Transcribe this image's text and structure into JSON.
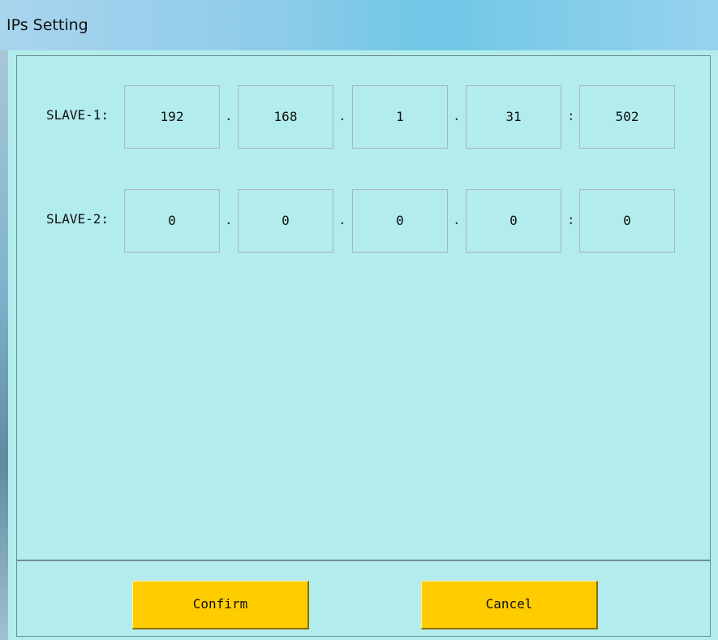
{
  "window": {
    "title": "IPs Setting"
  },
  "slaves": [
    {
      "label": "SLAVE-1:",
      "octets": [
        "192",
        "168",
        "1",
        "31"
      ],
      "port": "502"
    },
    {
      "label": "SLAVE-2:",
      "octets": [
        "0",
        "0",
        "0",
        "0"
      ],
      "port": "0"
    }
  ],
  "separators": {
    "dot": ".",
    "colon": ":"
  },
  "buttons": {
    "confirm": "Confirm",
    "cancel": "Cancel"
  },
  "colors": {
    "background": "#b2ecec",
    "button": "#ffcc00"
  }
}
